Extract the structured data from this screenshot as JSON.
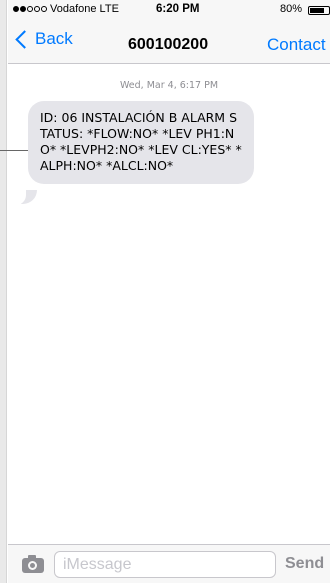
{
  "status_bar": {
    "carrier": "Vodafone LTE",
    "time": "6:20 PM",
    "battery": "80%",
    "signal_bars_filled": 2,
    "signal_bars_total": 5
  },
  "nav": {
    "back_label": "Back",
    "title": "600100200",
    "contact_label": "Contact"
  },
  "conversation": {
    "timestamp": "Wed, Mar 4, 6:17 PM",
    "messages": [
      {
        "direction": "incoming",
        "text": "ID: 06 INSTALACIÓN B ALARM STATUS: *FLOW:NO* *LEV PH1:NO* *LEVPH2:NO* *LEV CL:YES* *ALPH:NO* *ALCL:NO*"
      }
    ]
  },
  "composer": {
    "placeholder": "iMessage",
    "send_label": "Send"
  },
  "colors": {
    "accent": "#007aff",
    "bubble_incoming": "#e5e5ea",
    "bar_background": "#f7f7f7",
    "muted": "#8e8e93"
  },
  "icons": {
    "back": "chevron-left-icon",
    "camera": "camera-icon",
    "battery": "battery-icon",
    "signal": "signal-dots-icon"
  }
}
